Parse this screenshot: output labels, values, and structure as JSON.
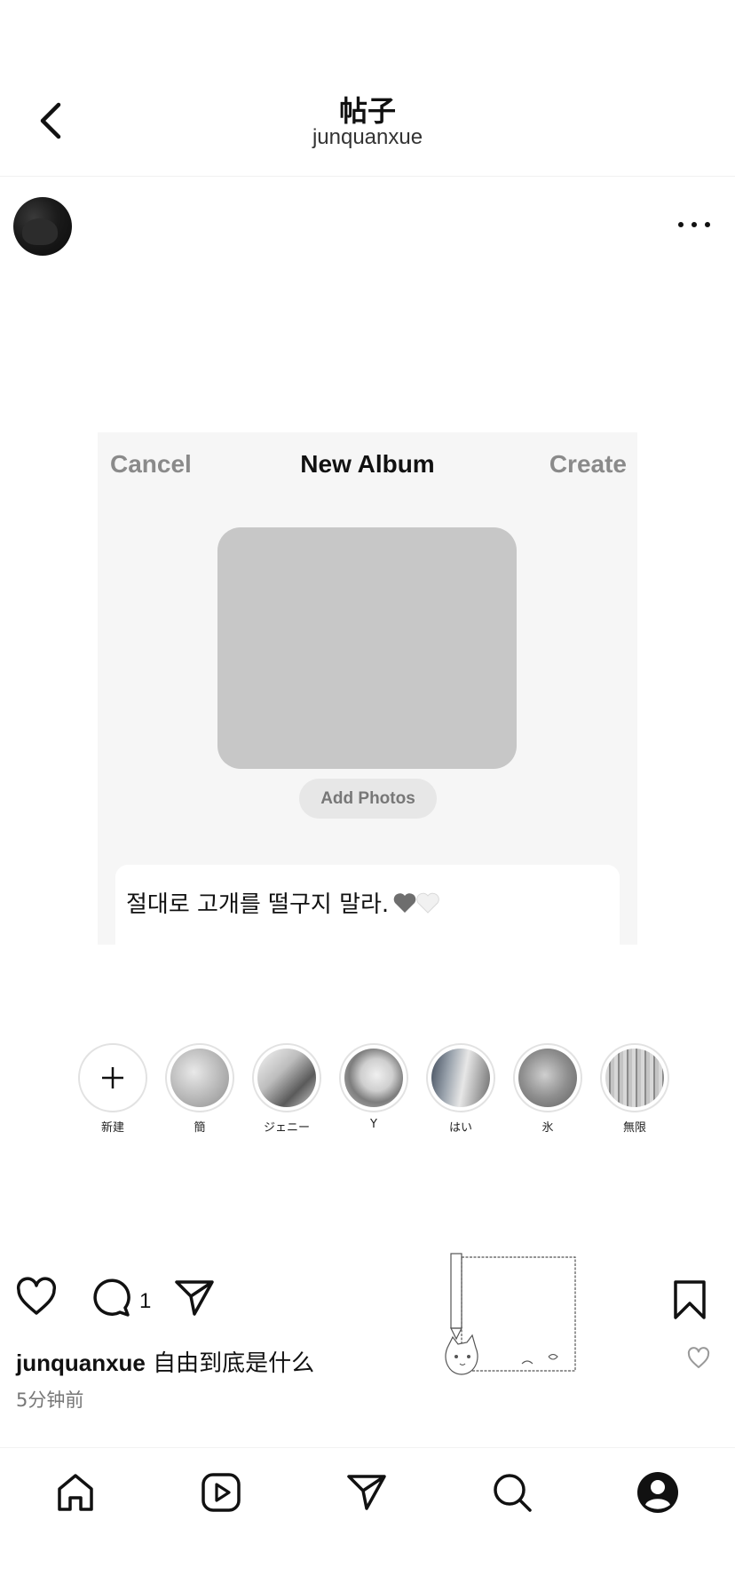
{
  "header": {
    "title": "帖子",
    "subtitle": "junquanxue"
  },
  "post": {
    "author": "junquanxue",
    "image": {
      "album": {
        "cancel_label": "Cancel",
        "title": "New Album",
        "create_label": "Create",
        "add_photos_label": "Add Photos",
        "field_text": "절대로 고개를 떨구지 말라."
      },
      "highlights": [
        {
          "label": "新建"
        },
        {
          "label": "簡"
        },
        {
          "label": "ジェニー"
        },
        {
          "label": "Y"
        },
        {
          "label": "はい"
        },
        {
          "label": "氷"
        },
        {
          "label": "無限"
        }
      ]
    },
    "actions": {
      "comment_count": "1"
    },
    "caption": {
      "username": "junquanxue",
      "text": "自由到底是什么"
    },
    "timestamp": "5分钟前"
  },
  "icons": {
    "back": "chevron-left-icon",
    "more": "more-horizontal-icon",
    "like": "heart-icon",
    "comment": "comment-icon",
    "share": "send-icon",
    "save": "bookmark-icon",
    "nav": [
      "home-icon",
      "reels-icon",
      "send-icon",
      "search-icon",
      "profile-icon"
    ]
  },
  "colors": {
    "text": "#111111",
    "muted": "#777777",
    "placeholder": "#c7c7c7"
  }
}
